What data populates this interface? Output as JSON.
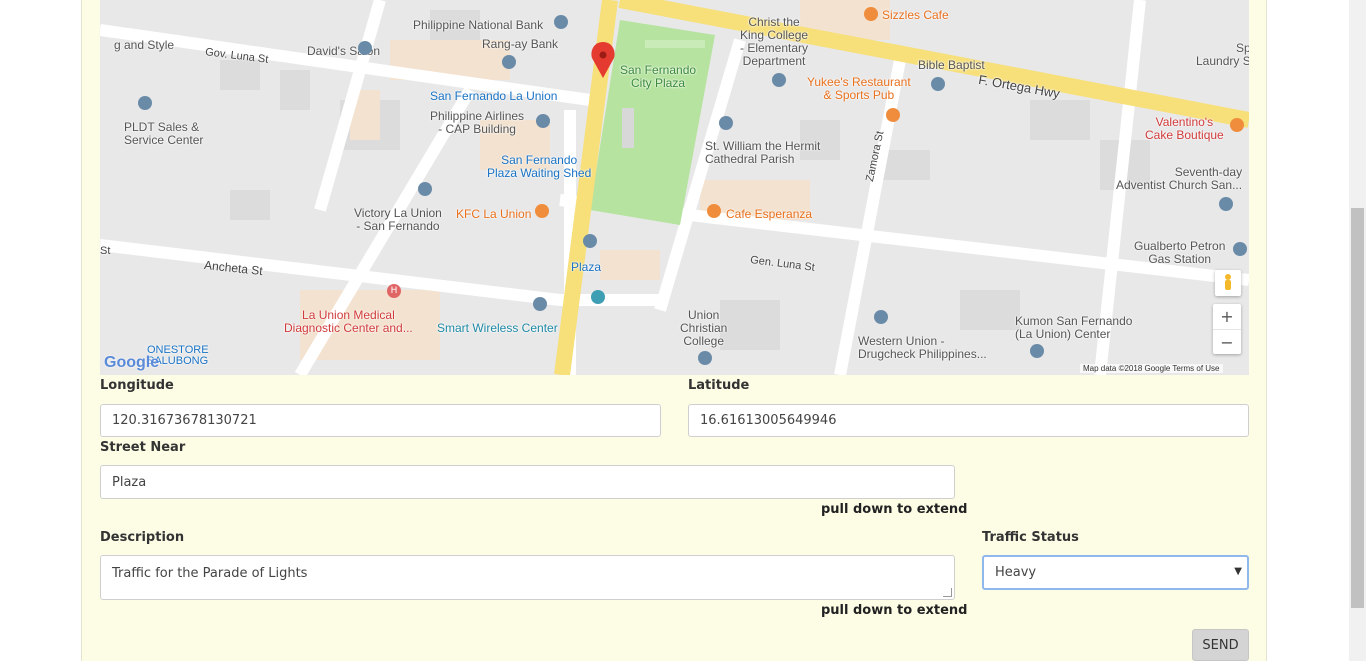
{
  "map": {
    "labels": {
      "and_style": "g and Style",
      "gov_luna": "Gov. Luna St",
      "davids_salon": "David's Salon",
      "pnb": "Philippine National Bank",
      "rangay": "Rang-ay Bank",
      "sf_la_union": "San Fernando La Union",
      "pal": "Philippine Airlines\n- CAP Building",
      "sf_plaza_shed": "San Fernando\nPlaza Waiting Shed",
      "city_plaza": "San Fernando\nCity Plaza",
      "christ_king": "Christ the\nKing College\n- Elementary\nDepartment",
      "sizzles": "Sizzles Cafe",
      "bible_baptist": "Bible Baptist",
      "f_ortega": "F. Ortega Hwy",
      "yukees": "Yukee's Restaurant\n& Sports Pub",
      "laundry": "Sp\nLaundry S",
      "valentinos": "Valentino's\nCake Boutique",
      "pldt": "PLDT Sales &\nService Center",
      "st_william": "St. William the Hermit\nCathedral Parish",
      "zamora": "Zamora St",
      "seventh_day": "Seventh-day\nAdventist Church San...",
      "victory": "Victory La Union\n- San Fernando",
      "kfc": "KFC La Union",
      "cafe_esperanza": "Cafe Esperanza",
      "anchetast": "Ancheta St",
      "plaza": "Plaza",
      "gen_luna": "Gen. Luna St",
      "gualberto": "Gualberto Petron\nGas Station",
      "lu_medical": "La Union Medical\nDiagnostic Center and...",
      "smart": "Smart Wireless Center",
      "ucc": "Union\nChristian\nCollege",
      "western_union": "Western Union -\nDrugcheck Philippines...",
      "kumon": "Kumon San Fernando\n(La Union) Center",
      "onestore": "ONESTORE\nSALUBONG",
      "st_left": "St"
    },
    "google_logo": "Google",
    "attribution": "Map data ©2018 Google   Terms of Use",
    "zoom_in": "+",
    "zoom_out": "−"
  },
  "form": {
    "longitude_label": "Longitude",
    "longitude_value": "120.31673678130721",
    "latitude_label": "Latitude",
    "latitude_value": "16.61613005649946",
    "street_label": "Street Near",
    "street_value": "Plaza",
    "street_hint": "pull down to extend",
    "description_label": "Description",
    "description_value": "Traffic for the Parade of Lights",
    "description_hint": "pull down to extend",
    "traffic_label": "Traffic Status",
    "traffic_value": "Heavy",
    "send_label": "SEND"
  }
}
